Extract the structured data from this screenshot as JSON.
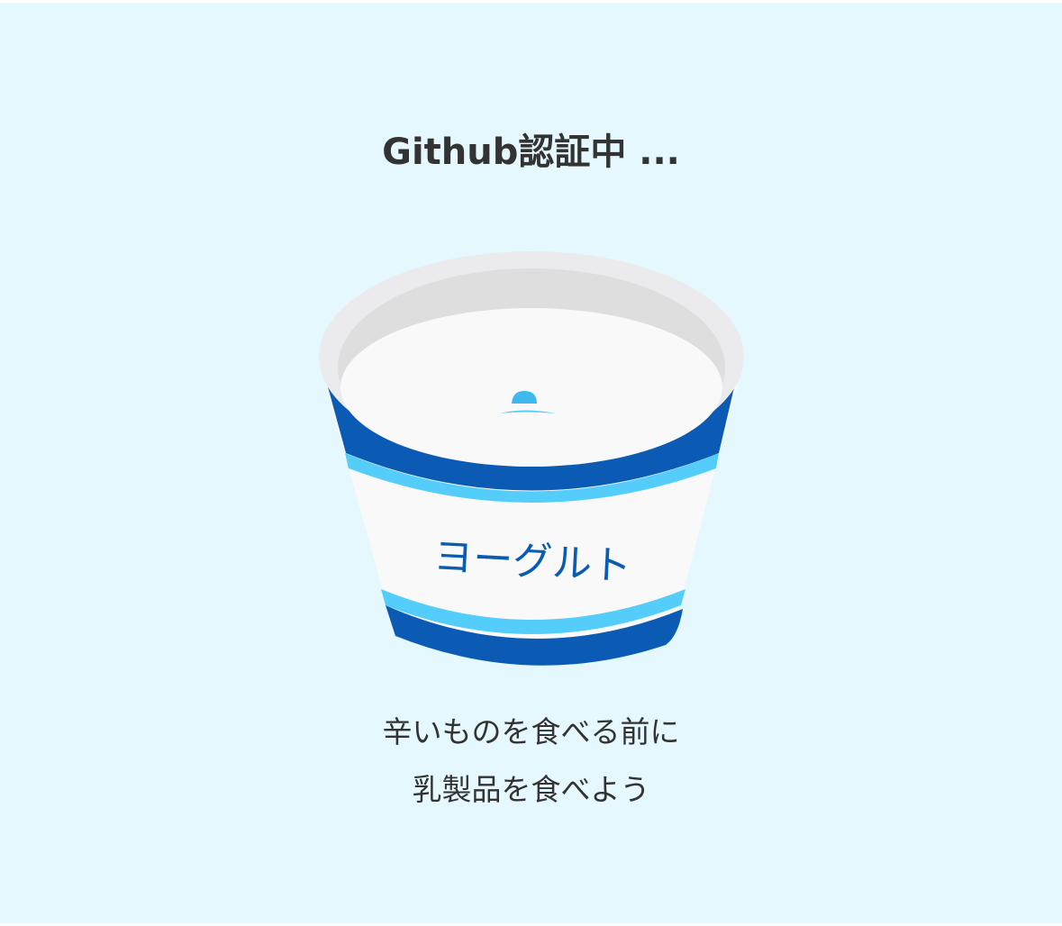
{
  "heading": "Github認証中 ...",
  "illustration": {
    "icon": "yogurt-cup-icon",
    "label": "ヨーグルト",
    "colors": {
      "band_dark": "#0b5bb5",
      "band_light": "#55cdfa",
      "cup_body": "#f9f9f9",
      "rim": "#ebebed",
      "drop": "#3fb8ee"
    }
  },
  "message": {
    "line1": "辛いものを食べる前に",
    "line2": "乳製品を食べよう"
  },
  "colors": {
    "background": "#e5f8fe",
    "text": "#333333"
  }
}
